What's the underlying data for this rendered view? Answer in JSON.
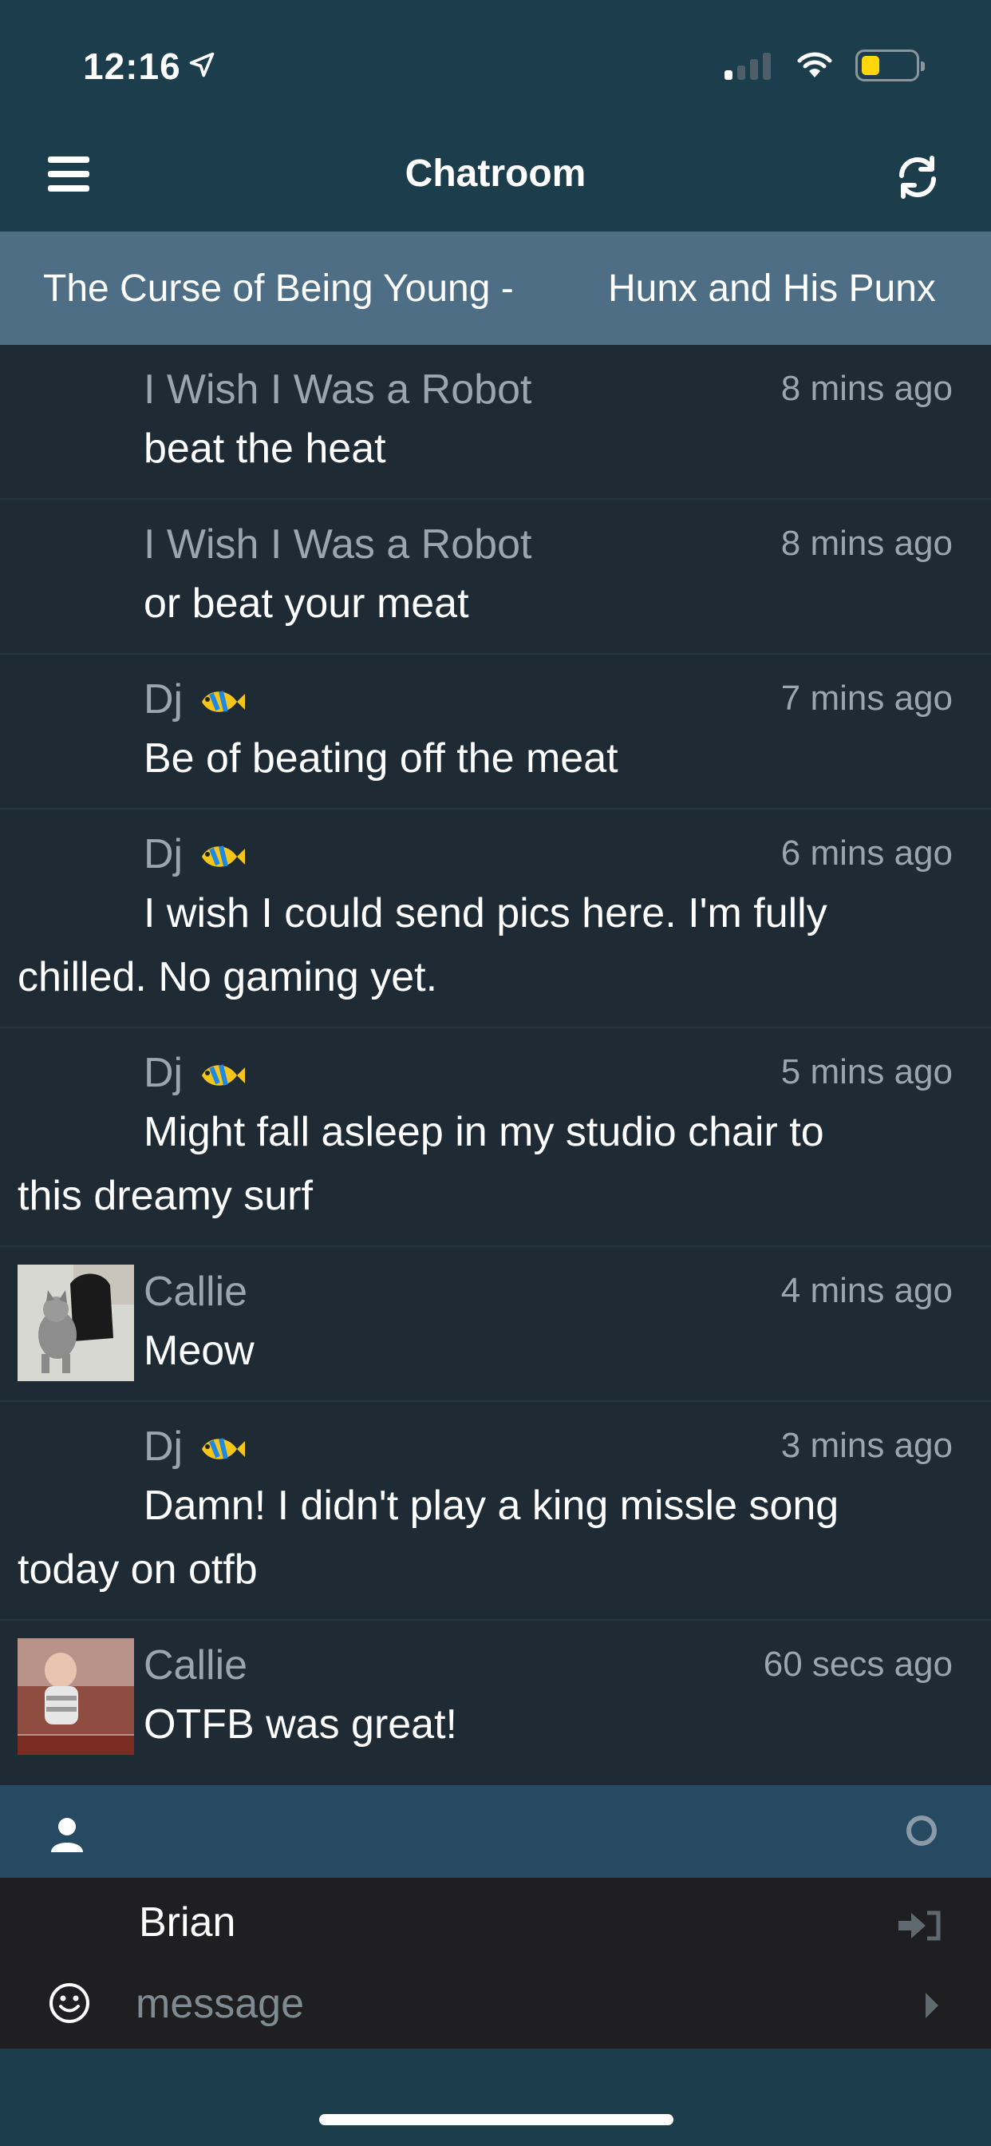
{
  "status_bar": {
    "time": "12:16",
    "icons": [
      "location-arrow-icon",
      "cellular-signal-icon",
      "wifi-icon",
      "battery-low-icon"
    ],
    "battery_color": "#ffd60a"
  },
  "header": {
    "title": "Chatroom",
    "left_icon": "menu-icon",
    "right_icon": "refresh-icon",
    "background": "#1c3d4c"
  },
  "now_playing": {
    "song": "The Curse of Being Young -",
    "artist": "Hunx and His Punx",
    "background": "#4d6e85"
  },
  "messages": [
    {
      "user": "I Wish I Was a Robot",
      "time": "8 mins ago",
      "lines": [
        "beat the heat"
      ]
    },
    {
      "user": "I Wish I Was a Robot",
      "time": "8 mins ago",
      "lines": [
        "or beat your meat"
      ]
    },
    {
      "user": "Dj",
      "user_icon": "tropical-fish-icon",
      "time": "7 mins ago",
      "lines": [
        "Be of beating off the meat"
      ]
    },
    {
      "user": "Dj",
      "user_icon": "tropical-fish-icon",
      "time": "6 mins ago",
      "lines": [
        "I wish I could send pics here. I'm fully",
        "chilled. No gaming yet."
      ]
    },
    {
      "user": "Dj",
      "user_icon": "tropical-fish-icon",
      "time": "5 mins ago",
      "lines": [
        "Might fall asleep in my studio chair to",
        "this dreamy surf"
      ]
    },
    {
      "user": "Callie",
      "avatar": "cat-photo-avatar",
      "time": "4 mins ago",
      "lines": [
        "Meow"
      ]
    },
    {
      "user": "Dj",
      "user_icon": "tropical-fish-icon",
      "time": "3 mins ago",
      "lines": [
        "Damn! I didn't play a king missle song",
        "today on otfb"
      ]
    },
    {
      "user": "Callie",
      "avatar": "baby-photo-avatar",
      "time": "60 secs ago",
      "lines": [
        "OTFB was great!"
      ]
    }
  ],
  "composer": {
    "name_value": "Brian",
    "message_placeholder": "message",
    "icons": [
      "person-icon",
      "status-circle-icon",
      "login-icon",
      "smiley-icon",
      "send-icon"
    ]
  },
  "colors": {
    "app_background": "#1e2b35",
    "user_bar": "#254a62",
    "input_area": "#1f1f21",
    "muted_text": "#9aa6ae"
  }
}
